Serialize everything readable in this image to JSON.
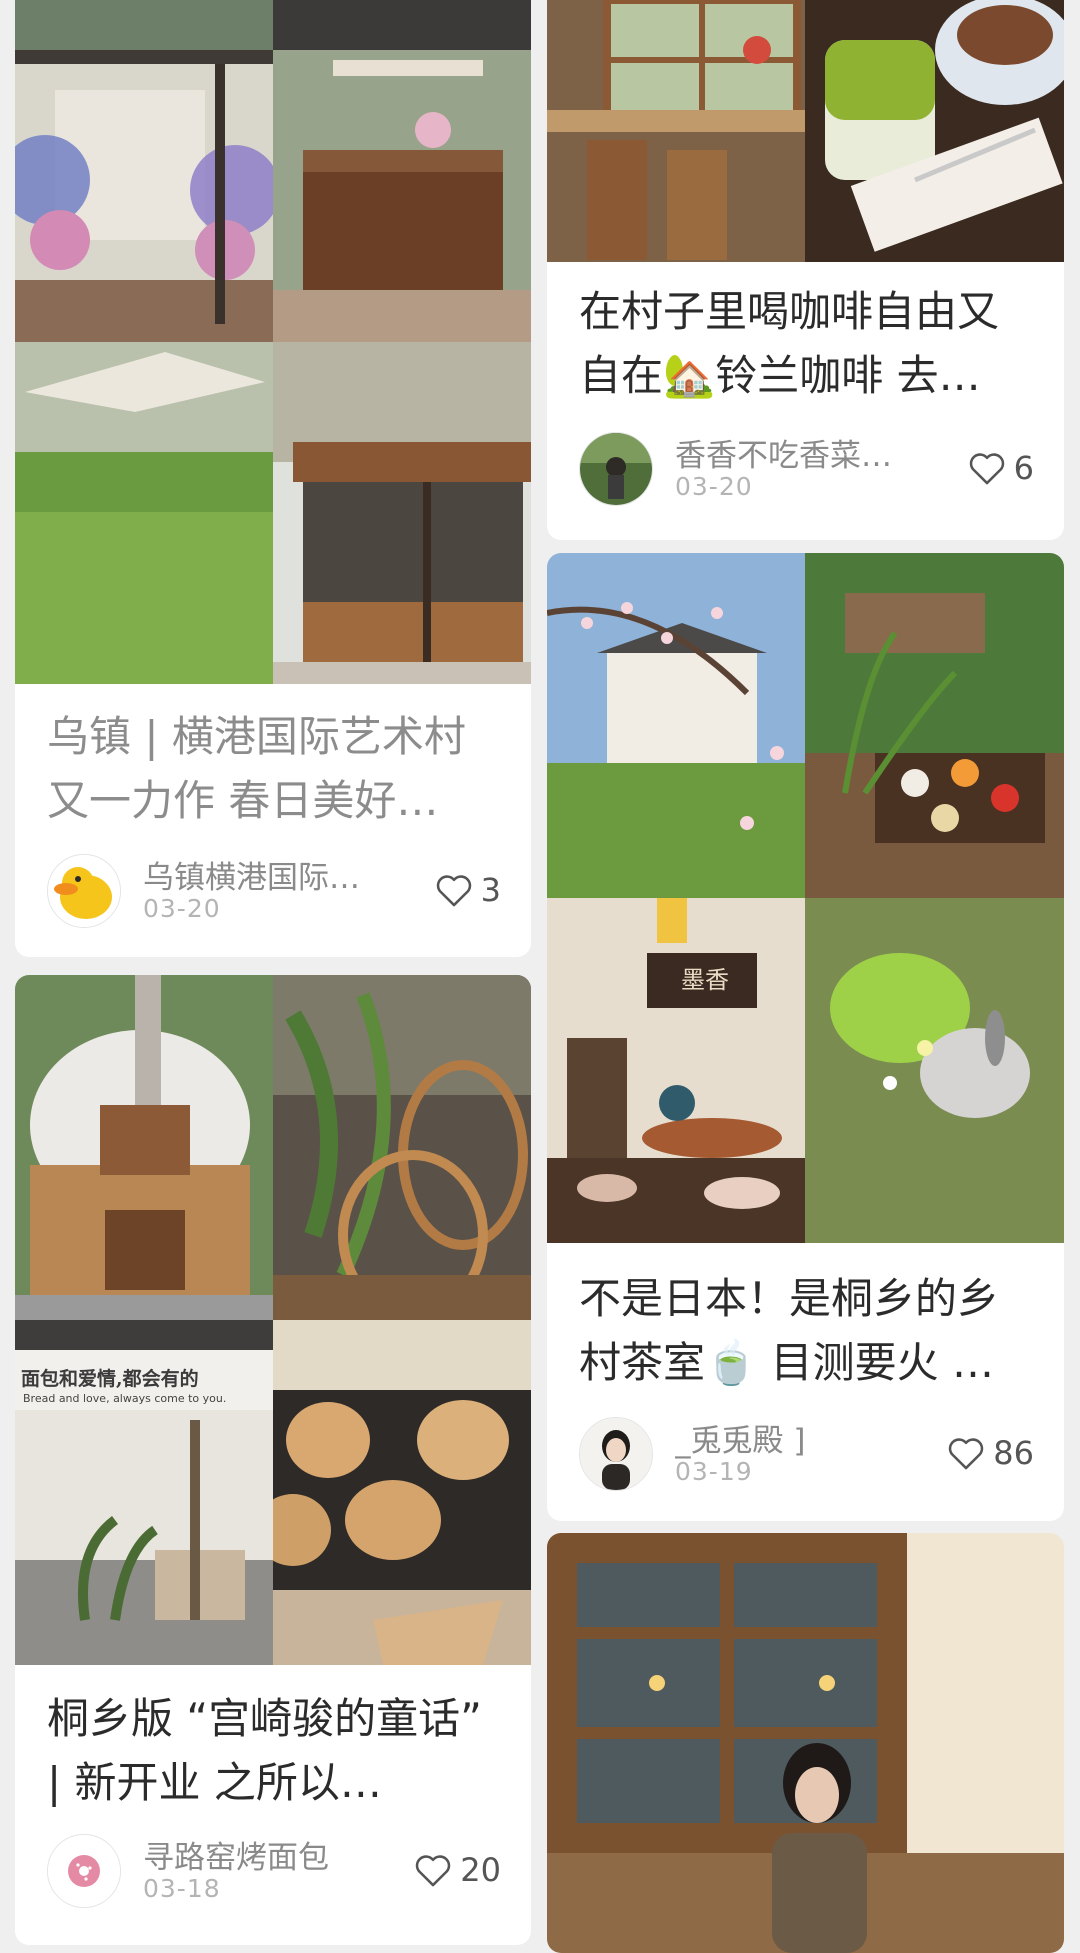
{
  "feed": {
    "cards": [
      {
        "title": "乌镇 | 横港国际艺术村又一力作 春日美好…",
        "author": "乌镇横港国际…",
        "date": "03-20",
        "likes": "3",
        "avatar_icon": "duck-avatar-icon"
      },
      {
        "title": "桐乡版 “宫崎骏的童话” | 新开业 之所以…",
        "author": "寻路窑烤面包",
        "date": "03-18",
        "likes": "20",
        "avatar_icon": "donut-avatar-icon",
        "photo_text": {
          "sign_cn": "面包和爱情,都会有的",
          "sign_en": "Bread and love, always come to you."
        }
      },
      {
        "title": "在村子里喝咖啡自由又自在🏡铃兰咖啡 去…",
        "author": "香香不吃香菜…",
        "date": "03-20",
        "likes": "6",
        "avatar_icon": "person-avatar-icon"
      },
      {
        "title": "不是日本！是桐乡的乡村茶室🍵 目测要火 …",
        "author": "_兎兎殿 ]",
        "date": "03-19",
        "likes": "86",
        "avatar_icon": "portrait-avatar-icon",
        "photo_text": {
          "plaque": "墨香"
        }
      },
      {
        "title": "",
        "author": "",
        "date": "",
        "likes": "",
        "avatar_icon": "window-photo"
      }
    ]
  },
  "colors": {
    "background": "#efefef",
    "card": "#ffffff",
    "title": "#2b2b2b",
    "meta": "#8a8a8a"
  }
}
